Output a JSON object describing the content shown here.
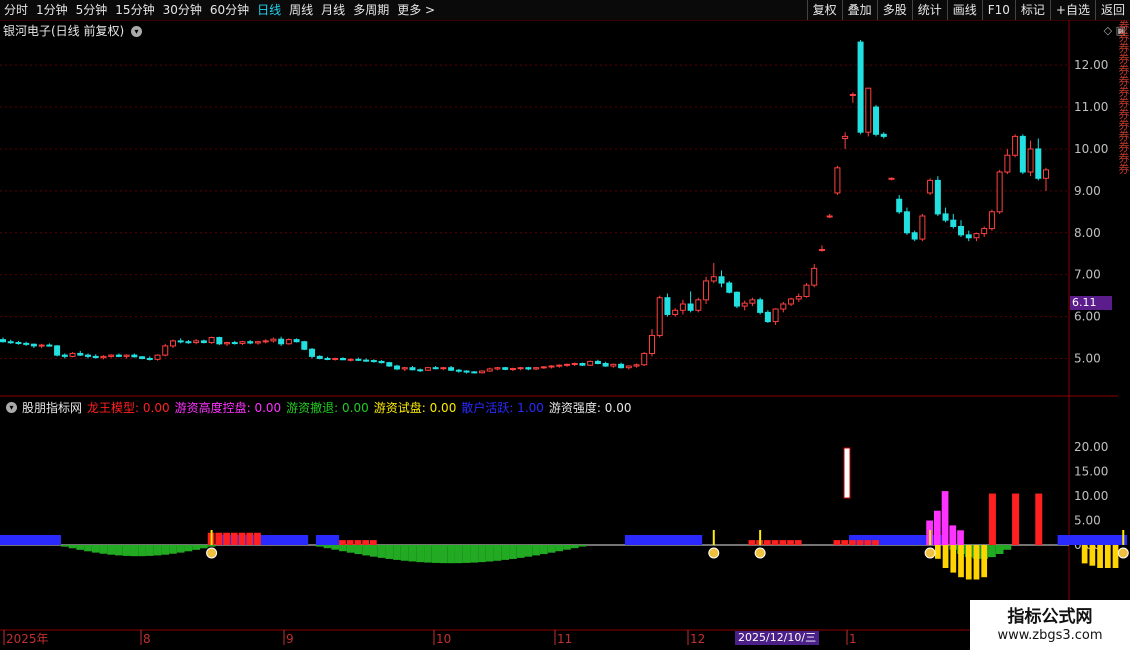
{
  "toolbar": {
    "periods": [
      "分时",
      "1分钟",
      "5分钟",
      "15分钟",
      "30分钟",
      "60分钟",
      "日线",
      "周线",
      "月线",
      "多周期",
      "更多 >"
    ],
    "active_period": "日线",
    "right_buttons": [
      "复权",
      "叠加",
      "多股",
      "统计",
      "画线",
      "F10",
      "标记",
      "+自选",
      "返回"
    ]
  },
  "stock": {
    "title": "银河电子(日线 前复权)",
    "current_price": "6.11"
  },
  "indicator": {
    "name": "股朋指标网",
    "legend": [
      {
        "label": "龙王模型: 0.00",
        "color": "#ff2020"
      },
      {
        "label": "游资高度控盘: 0.00",
        "color": "#ff33ff"
      },
      {
        "label": "游资撤退: 0.00",
        "color": "#22cc22"
      },
      {
        "label": "游资试盘: 0.00",
        "color": "#ffee00"
      },
      {
        "label": "散户活跃: 1.00",
        "color": "#2a2aff"
      },
      {
        "label": "游资强度: 0.00",
        "color": "#e6e6e6"
      }
    ]
  },
  "price_axis": [
    "12.00",
    "11.00",
    "10.00",
    "9.00",
    "8.00",
    "7.00",
    "6.00",
    "5.00"
  ],
  "indicator_axis": [
    "20.00",
    "15.00",
    "10.00",
    "5.00",
    "0.00"
  ],
  "time_axis": [
    "2025年",
    "8",
    "9",
    "10",
    "11",
    "12",
    "1"
  ],
  "date_badge": "2025/12/10/三",
  "watermark": {
    "title": "指标公式网",
    "url": "www.zbgs3.com"
  },
  "right_strip_text": "券券券券券券券券券券券券券券",
  "colors": {
    "up": "#ff4040",
    "down": "#22e0e0",
    "grid": "#5a0000",
    "panel_border": "#8b0000"
  },
  "chart_data": {
    "type": "candlestick",
    "title": "银河电子(日线 前复权)",
    "ylim": [
      4.2,
      12.6
    ],
    "candles": [
      [
        5.45,
        5.5,
        5.38,
        5.4
      ],
      [
        5.4,
        5.45,
        5.35,
        5.38
      ],
      [
        5.38,
        5.42,
        5.33,
        5.36
      ],
      [
        5.36,
        5.4,
        5.3,
        5.34
      ],
      [
        5.34,
        5.36,
        5.25,
        5.3
      ],
      [
        5.3,
        5.35,
        5.25,
        5.32
      ],
      [
        5.32,
        5.36,
        5.28,
        5.3
      ],
      [
        5.3,
        5.32,
        5.05,
        5.08
      ],
      [
        5.08,
        5.12,
        5.0,
        5.05
      ],
      [
        5.05,
        5.15,
        5.03,
        5.12
      ],
      [
        5.12,
        5.18,
        5.06,
        5.08
      ],
      [
        5.08,
        5.12,
        5.0,
        5.05
      ],
      [
        5.05,
        5.1,
        5.0,
        5.02
      ],
      [
        5.02,
        5.08,
        4.98,
        5.05
      ],
      [
        5.05,
        5.1,
        5.02,
        5.08
      ],
      [
        5.08,
        5.12,
        5.03,
        5.05
      ],
      [
        5.05,
        5.1,
        5.0,
        5.08
      ],
      [
        5.08,
        5.12,
        5.02,
        5.04
      ],
      [
        5.04,
        5.06,
        4.98,
        5.0
      ],
      [
        5.0,
        5.05,
        4.95,
        4.98
      ],
      [
        4.98,
        5.1,
        4.95,
        5.08
      ],
      [
        5.08,
        5.35,
        5.05,
        5.3
      ],
      [
        5.3,
        5.45,
        5.25,
        5.42
      ],
      [
        5.42,
        5.48,
        5.36,
        5.4
      ],
      [
        5.4,
        5.44,
        5.35,
        5.38
      ],
      [
        5.38,
        5.46,
        5.34,
        5.42
      ],
      [
        5.42,
        5.45,
        5.36,
        5.38
      ],
      [
        5.38,
        5.52,
        5.35,
        5.5
      ],
      [
        5.5,
        5.52,
        5.32,
        5.35
      ],
      [
        5.35,
        5.4,
        5.3,
        5.38
      ],
      [
        5.38,
        5.42,
        5.33,
        5.36
      ],
      [
        5.36,
        5.42,
        5.32,
        5.4
      ],
      [
        5.4,
        5.44,
        5.34,
        5.37
      ],
      [
        5.37,
        5.42,
        5.33,
        5.4
      ],
      [
        5.4,
        5.46,
        5.36,
        5.42
      ],
      [
        5.42,
        5.5,
        5.38,
        5.46
      ],
      [
        5.46,
        5.52,
        5.3,
        5.35
      ],
      [
        5.35,
        5.48,
        5.33,
        5.45
      ],
      [
        5.45,
        5.48,
        5.38,
        5.4
      ],
      [
        5.4,
        5.42,
        5.2,
        5.22
      ],
      [
        5.22,
        5.25,
        5.0,
        5.05
      ],
      [
        5.05,
        5.08,
        4.98,
        5.0
      ],
      [
        5.0,
        5.04,
        4.96,
        4.98
      ],
      [
        4.98,
        5.02,
        4.95,
        5.0
      ],
      [
        5.0,
        5.03,
        4.96,
        4.97
      ],
      [
        4.97,
        5.0,
        4.93,
        4.98
      ],
      [
        4.98,
        5.02,
        4.94,
        4.96
      ],
      [
        4.96,
        5.0,
        4.92,
        4.95
      ],
      [
        4.95,
        4.98,
        4.9,
        4.93
      ],
      [
        4.93,
        4.96,
        4.88,
        4.9
      ],
      [
        4.9,
        4.92,
        4.8,
        4.82
      ],
      [
        4.82,
        4.85,
        4.72,
        4.75
      ],
      [
        4.75,
        4.8,
        4.7,
        4.78
      ],
      [
        4.78,
        4.82,
        4.72,
        4.73
      ],
      [
        4.73,
        4.76,
        4.68,
        4.72
      ],
      [
        4.72,
        4.8,
        4.7,
        4.78
      ],
      [
        4.78,
        4.82,
        4.74,
        4.76
      ],
      [
        4.76,
        4.8,
        4.72,
        4.78
      ],
      [
        4.78,
        4.82,
        4.7,
        4.72
      ],
      [
        4.72,
        4.75,
        4.66,
        4.7
      ],
      [
        4.7,
        4.72,
        4.64,
        4.68
      ],
      [
        4.68,
        4.7,
        4.64,
        4.66
      ],
      [
        4.66,
        4.72,
        4.64,
        4.7
      ],
      [
        4.7,
        4.78,
        4.68,
        4.75
      ],
      [
        4.75,
        4.8,
        4.72,
        4.78
      ],
      [
        4.78,
        4.8,
        4.72,
        4.74
      ],
      [
        4.74,
        4.78,
        4.7,
        4.76
      ],
      [
        4.76,
        4.8,
        4.72,
        4.78
      ],
      [
        4.78,
        4.8,
        4.72,
        4.75
      ],
      [
        4.75,
        4.8,
        4.72,
        4.78
      ],
      [
        4.78,
        4.82,
        4.75,
        4.8
      ],
      [
        4.8,
        4.84,
        4.76,
        4.82
      ],
      [
        4.82,
        4.86,
        4.78,
        4.84
      ],
      [
        4.84,
        4.88,
        4.8,
        4.86
      ],
      [
        4.86,
        4.9,
        4.82,
        4.88
      ],
      [
        4.88,
        4.9,
        4.82,
        4.84
      ],
      [
        4.84,
        4.95,
        4.82,
        4.93
      ],
      [
        4.93,
        4.97,
        4.86,
        4.88
      ],
      [
        4.88,
        4.92,
        4.8,
        4.82
      ],
      [
        4.82,
        4.88,
        4.78,
        4.86
      ],
      [
        4.86,
        4.9,
        4.76,
        4.78
      ],
      [
        4.78,
        4.84,
        4.74,
        4.82
      ],
      [
        4.82,
        4.88,
        4.78,
        4.85
      ],
      [
        4.85,
        5.15,
        4.82,
        5.12
      ],
      [
        5.12,
        5.7,
        5.05,
        5.55
      ],
      [
        5.55,
        6.5,
        5.5,
        6.45
      ],
      [
        6.45,
        6.55,
        6.0,
        6.05
      ],
      [
        6.05,
        6.2,
        6.0,
        6.15
      ],
      [
        6.15,
        6.4,
        6.05,
        6.3
      ],
      [
        6.3,
        6.6,
        6.1,
        6.15
      ],
      [
        6.15,
        6.45,
        6.1,
        6.4
      ],
      [
        6.4,
        6.95,
        6.3,
        6.85
      ],
      [
        6.85,
        7.28,
        6.8,
        6.95
      ],
      [
        6.95,
        7.1,
        6.7,
        6.8
      ],
      [
        6.8,
        6.85,
        6.55,
        6.58
      ],
      [
        6.58,
        6.6,
        6.2,
        6.25
      ],
      [
        6.25,
        6.38,
        6.15,
        6.32
      ],
      [
        6.32,
        6.45,
        6.25,
        6.4
      ],
      [
        6.4,
        6.45,
        6.05,
        6.1
      ],
      [
        6.1,
        6.15,
        5.85,
        5.88
      ],
      [
        5.88,
        6.2,
        5.8,
        6.18
      ],
      [
        6.18,
        6.35,
        6.1,
        6.3
      ],
      [
        6.3,
        6.45,
        6.25,
        6.42
      ],
      [
        6.42,
        6.55,
        6.35,
        6.48
      ],
      [
        6.48,
        6.8,
        6.45,
        6.75
      ],
      [
        6.75,
        7.25,
        6.7,
        7.15
      ],
      [
        7.6,
        7.7,
        7.55,
        7.6
      ],
      [
        8.4,
        8.45,
        8.35,
        8.4
      ],
      [
        8.95,
        9.6,
        8.9,
        9.55
      ],
      [
        10.25,
        10.4,
        10.0,
        10.3
      ],
      [
        11.3,
        11.35,
        11.1,
        11.3
      ],
      [
        12.55,
        12.6,
        10.35,
        10.4
      ],
      [
        10.4,
        11.45,
        10.3,
        11.45
      ],
      [
        11.0,
        11.05,
        10.3,
        10.35
      ],
      [
        10.35,
        10.4,
        10.25,
        10.3
      ],
      [
        9.3,
        9.32,
        9.25,
        9.3
      ],
      [
        8.8,
        8.9,
        8.45,
        8.5
      ],
      [
        8.5,
        8.6,
        7.95,
        8.0
      ],
      [
        8.0,
        8.05,
        7.8,
        7.85
      ],
      [
        7.85,
        8.45,
        7.8,
        8.4
      ],
      [
        8.95,
        9.3,
        8.9,
        9.25
      ],
      [
        9.25,
        9.35,
        8.4,
        8.45
      ],
      [
        8.45,
        8.6,
        8.25,
        8.3
      ],
      [
        8.3,
        8.45,
        8.1,
        8.15
      ],
      [
        8.15,
        8.3,
        7.9,
        7.95
      ],
      [
        7.95,
        8.05,
        7.8,
        7.88
      ],
      [
        7.88,
        8.0,
        7.8,
        7.98
      ],
      [
        7.98,
        8.15,
        7.9,
        8.1
      ],
      [
        8.1,
        8.55,
        8.05,
        8.5
      ],
      [
        8.5,
        9.5,
        8.45,
        9.45
      ],
      [
        9.45,
        10.0,
        9.4,
        9.85
      ],
      [
        9.85,
        10.35,
        9.8,
        10.3
      ],
      [
        10.3,
        10.35,
        9.4,
        9.45
      ],
      [
        9.45,
        10.2,
        9.35,
        10.0
      ],
      [
        10.0,
        10.25,
        9.25,
        9.3
      ],
      [
        9.3,
        9.55,
        9.0,
        9.5
      ]
    ],
    "indicator_series": [
      {
        "name": "散户活跃",
        "ranges": [
          [
            0,
            7,
            1
          ]
        ],
        "blue_ranges": [
          [
            0,
            7
          ],
          [
            28,
            39
          ],
          [
            41,
            43
          ],
          [
            81,
            90
          ],
          [
            110,
            121
          ],
          [
            137,
            145
          ],
          [
            176,
            179
          ]
        ]
      }
    ]
  }
}
